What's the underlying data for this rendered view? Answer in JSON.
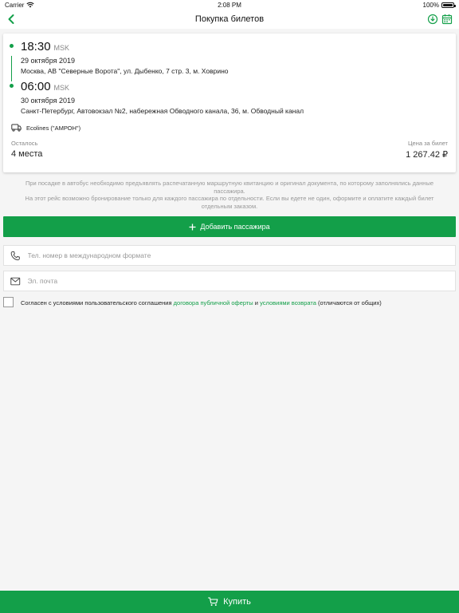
{
  "status_bar": {
    "carrier": "Carrier",
    "time": "2:08 PM",
    "battery": "100%"
  },
  "nav": {
    "title": "Покупка билетов"
  },
  "trip": {
    "departure": {
      "time": "18:30",
      "timezone": "MSK",
      "date": "29 октября 2019",
      "address": "Москва, АВ \"Северные Ворота\", ул. Дыбенко, 7 стр. 3, м. Ховрино"
    },
    "arrival": {
      "time": "06:00",
      "timezone": "MSK",
      "date": "30 октября 2019",
      "address": "Санкт-Петербург, Автовокзал №2, набережная Обводного канала, 36, м. Обводный канал"
    },
    "carrier": "Ecolines (\"АМРОН\")",
    "seats_label": "Осталось",
    "seats_value": "4 места",
    "price_label": "Цена за билет",
    "price_value": "1 267.42 ₽"
  },
  "notice": {
    "line1": "При посадке в автобус необходимо предъявлять распечатанную маршрутную квитанцию и оригинал документа, по которому заполнялись данные пассажира.",
    "line2": "На этот рейс возможно бронирование только для каждого пассажира по отдельности. Если вы едете не один, оформите и оплатите каждый билет отдельным заказом."
  },
  "add_passenger": {
    "label": "Добавить пассажира"
  },
  "phone_field": {
    "placeholder": "Тел. номер в международном формате",
    "value": ""
  },
  "email_field": {
    "placeholder": "Эл. почта",
    "value": ""
  },
  "agreement": {
    "prefix": "Согласен с условиями пользовательского соглашения",
    "offer_link": "договора публичной оферты",
    "and": "и",
    "return_link": "условиями возврата",
    "suffix": "(отличаются от общих)"
  },
  "buy_button": {
    "label": "Купить"
  },
  "colors": {
    "accent": "#139f49",
    "background": "#f5f5f5",
    "muted_text": "#999999"
  }
}
